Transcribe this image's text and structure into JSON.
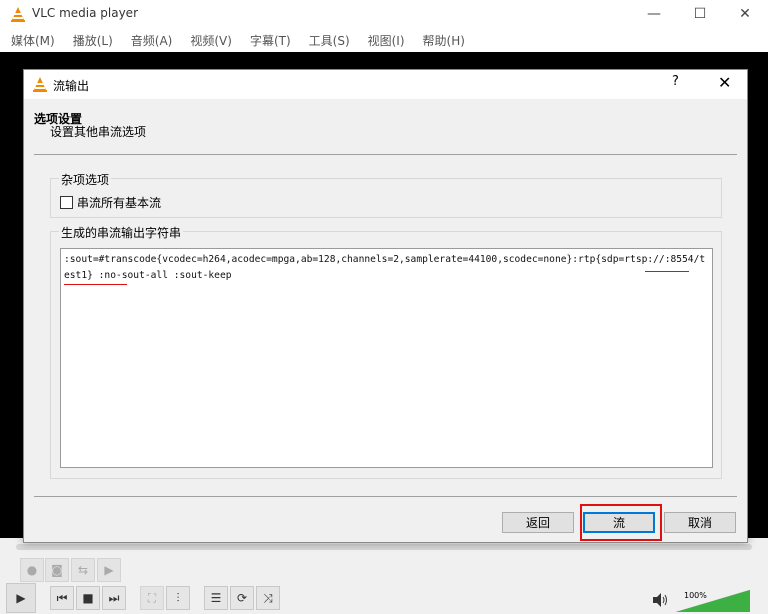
{
  "window": {
    "title": "VLC media player",
    "minimize": "—",
    "maximize": "☐",
    "close": "✕"
  },
  "menu": [
    {
      "label": "媒体(M)"
    },
    {
      "label": "播放(L)"
    },
    {
      "label": "音频(A)"
    },
    {
      "label": "视频(V)"
    },
    {
      "label": "字幕(T)"
    },
    {
      "label": "工具(S)"
    },
    {
      "label": "视图(I)"
    },
    {
      "label": "帮助(H)"
    }
  ],
  "dialog": {
    "title": "流输出",
    "help": "?",
    "close": "✕",
    "header_title": "选项设置",
    "header_subtitle": "设置其他串流选项",
    "misc_group_title": "杂项选项",
    "stream_all_label": "串流所有基本流",
    "stream_all_checked": false,
    "output_group_title": "生成的串流输出字符串",
    "output_string": ":sout=#transcode{vcodec=h264,acodec=mpga,ab=128,channels=2,samplerate=44100,scodec=none}:rtp{sdp=rtsp://:8554/test1} :no-sout-all :sout-keep",
    "back_label": "返回",
    "stream_label": "流",
    "cancel_label": "取消"
  },
  "controls": {
    "volume_label": "100%",
    "volume_level": 1.0
  },
  "colors": {
    "annotation": "#e01010",
    "vlc_orange": "#f08a00",
    "volume_green": "#3cb043"
  }
}
